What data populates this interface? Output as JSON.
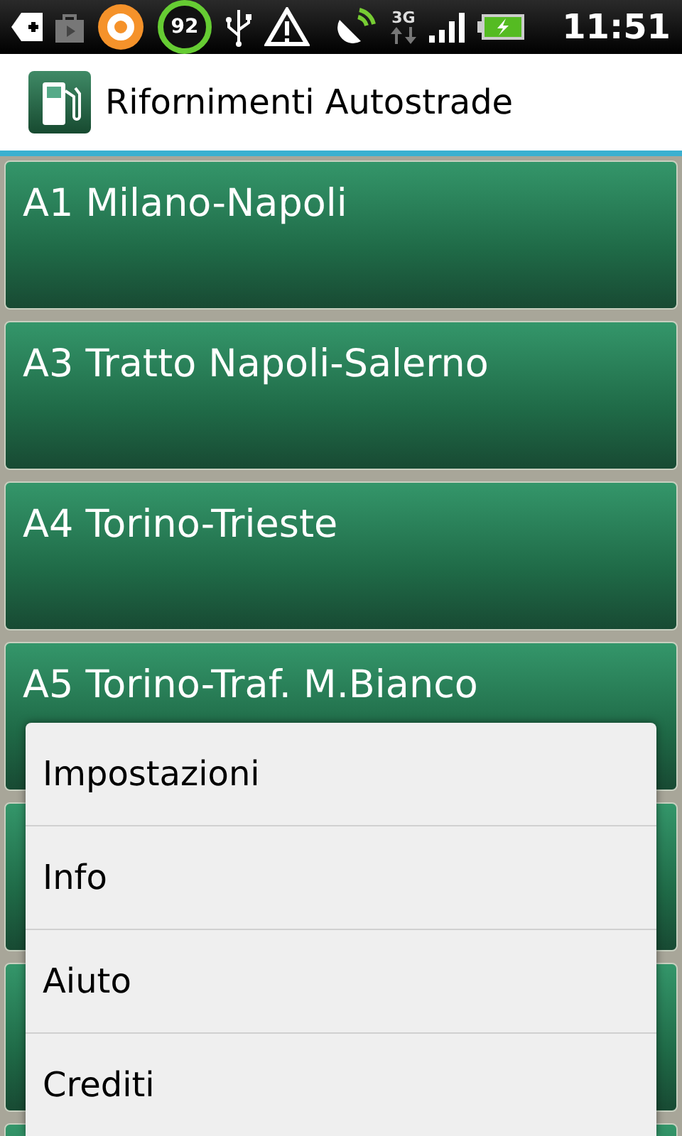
{
  "status_bar": {
    "battery_percent": "92",
    "network": "3G",
    "time": "11:51"
  },
  "app_bar": {
    "title": "Rifornimenti Autostrade"
  },
  "routes": [
    {
      "kind": "card",
      "label": "A1 Milano-Napoli"
    },
    {
      "kind": "card",
      "label": "A3 Tratto Napoli-Salerno"
    },
    {
      "kind": "card",
      "label": "A4 Torino-Trieste"
    },
    {
      "kind": "card",
      "label": "A5 Torino-Traf. M.Bianco"
    },
    {
      "kind": "covered"
    },
    {
      "kind": "covered"
    },
    {
      "kind": "covered"
    }
  ],
  "options_menu": {
    "items": [
      {
        "label": "Impostazioni"
      },
      {
        "label": "Info"
      },
      {
        "label": "Aiuto"
      },
      {
        "label": "Crediti"
      }
    ]
  }
}
